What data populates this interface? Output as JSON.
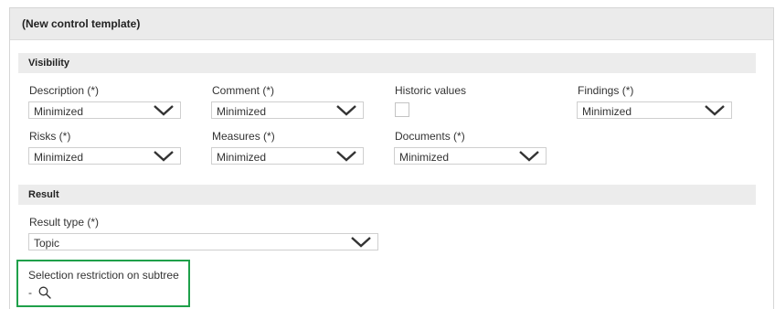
{
  "panel": {
    "title": "(New control template)"
  },
  "visibility": {
    "title": "Visibility",
    "description": {
      "label": "Description (*)",
      "value": "Minimized"
    },
    "comment": {
      "label": "Comment (*)",
      "value": "Minimized"
    },
    "historic": {
      "label": "Historic values",
      "checked": false
    },
    "findings": {
      "label": "Findings (*)",
      "value": "Minimized"
    },
    "risks": {
      "label": "Risks (*)",
      "value": "Minimized"
    },
    "measures": {
      "label": "Measures (*)",
      "value": "Minimized"
    },
    "documents": {
      "label": "Documents (*)",
      "value": "Minimized"
    }
  },
  "result": {
    "title": "Result",
    "type": {
      "label": "Result type (*)",
      "value": "Topic"
    },
    "restriction": {
      "label": "Selection restriction on subtree",
      "value": "-"
    }
  },
  "icons": {
    "dropdown": "chevron-down-icon",
    "search": "search-icon"
  },
  "colors": {
    "highlight": "#1fa04a",
    "header_bg": "#ebebeb",
    "section_bg": "#ececec"
  }
}
